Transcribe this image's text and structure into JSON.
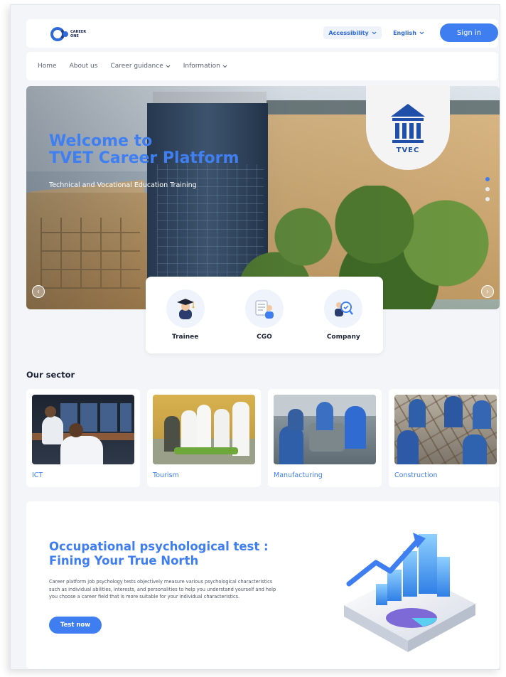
{
  "header": {
    "logo_text": "CAREER\nONE",
    "accessibility_label": "Accessibility",
    "language_label": "English",
    "signin_label": "Sign in"
  },
  "nav": {
    "items": [
      {
        "label": "Home",
        "dropdown": false
      },
      {
        "label": "About us",
        "dropdown": false
      },
      {
        "label": "Career guidance",
        "dropdown": true
      },
      {
        "label": "Information",
        "dropdown": true
      }
    ]
  },
  "hero": {
    "title": "Welcome to\nTVET Career Platform",
    "subtitle": "Technical and Vocational Education Training",
    "badge_text": "TVEC",
    "slides_total": 3,
    "active_slide": 1
  },
  "roles": [
    {
      "label": "Trainee",
      "icon": "graduate-icon"
    },
    {
      "label": "CGO",
      "icon": "document-person-icon"
    },
    {
      "label": "Company",
      "icon": "search-person-icon"
    }
  ],
  "sector": {
    "title": "Our sector",
    "items": [
      {
        "label": "ICT"
      },
      {
        "label": "Tourism"
      },
      {
        "label": "Manufacturing"
      },
      {
        "label": "Construction"
      }
    ]
  },
  "psych": {
    "title": "Occupational psychological test :\nFining Your True North",
    "body": "Career platform job psychology tests objectively measure various psychological characteristics such as individual abilities, interests, and personalities to help you understand yourself and help you choose a career field that is more suitable for your individual characteristics.",
    "button_label": "Test now"
  },
  "colors": {
    "accent": "#3e7ef0",
    "background": "#f3f5f9"
  }
}
